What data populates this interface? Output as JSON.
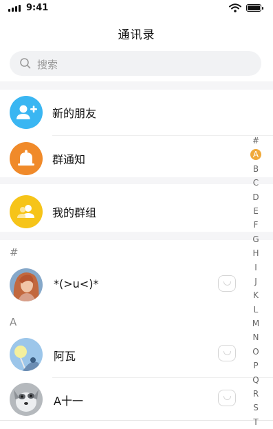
{
  "status_bar": {
    "time": "9:41"
  },
  "header": {
    "title": "通讯录"
  },
  "search": {
    "placeholder": "搜索"
  },
  "features": [
    {
      "label": "新的朋友",
      "icon": "add-user-icon",
      "color": "#3ab6f2"
    },
    {
      "label": "群通知",
      "icon": "bell-icon",
      "color": "#f08a2a"
    },
    {
      "label": "我的群组",
      "icon": "group-icon",
      "color": "#f6c419"
    }
  ],
  "sections": [
    {
      "title": "#",
      "contacts": [
        {
          "name": "*(>u<)*"
        }
      ]
    },
    {
      "title": "A",
      "contacts": [
        {
          "name": "阿瓦"
        },
        {
          "name": "A十一"
        }
      ]
    }
  ],
  "index_letters": [
    "#",
    "A",
    "B",
    "C",
    "D",
    "E",
    "F",
    "G",
    "H",
    "I",
    "J",
    "K",
    "L",
    "M",
    "N",
    "O",
    "P",
    "Q",
    "R",
    "S",
    "T"
  ],
  "index_active": "A",
  "colors": {
    "index_active": "#f0a93a"
  }
}
